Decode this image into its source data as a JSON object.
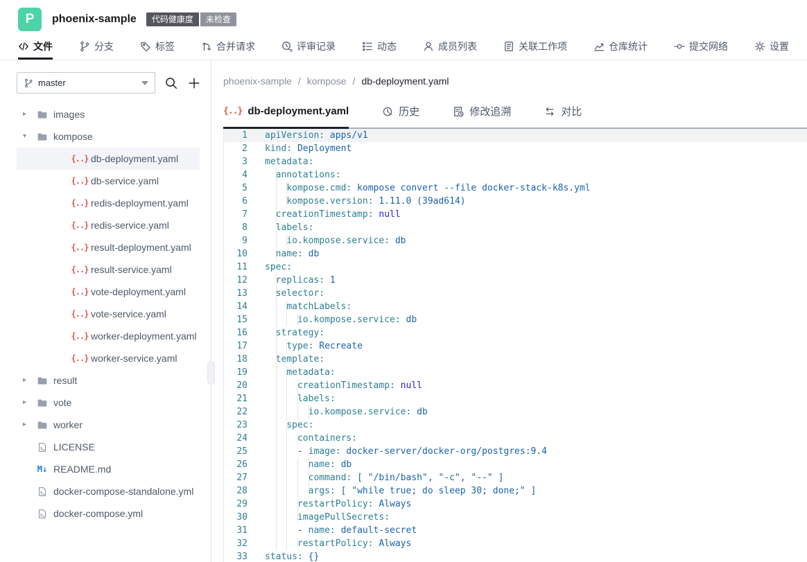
{
  "header": {
    "logo_letter": "P",
    "project_name": "phoenix-sample",
    "badges": [
      {
        "label": "代码健康度"
      },
      {
        "label": "未检查"
      }
    ],
    "nav": [
      {
        "id": "files",
        "icon": "code",
        "label": "文件",
        "active": true
      },
      {
        "id": "branches",
        "icon": "branch",
        "label": "分支"
      },
      {
        "id": "tags",
        "icon": "tag",
        "label": "标签"
      },
      {
        "id": "merge-requests",
        "icon": "merge",
        "label": "合并请求"
      },
      {
        "id": "reviews",
        "icon": "review",
        "label": "评审记录"
      },
      {
        "id": "activity",
        "icon": "activity",
        "label": "动态"
      },
      {
        "id": "members",
        "icon": "members",
        "label": "成员列表"
      },
      {
        "id": "work-items",
        "icon": "workitem",
        "label": "关联工作项"
      },
      {
        "id": "repo-stats",
        "icon": "stats",
        "label": "仓库统计"
      },
      {
        "id": "commit-network",
        "icon": "network",
        "label": "提交网络"
      },
      {
        "id": "settings",
        "icon": "gear",
        "label": "设置"
      }
    ]
  },
  "sidebar": {
    "branch": "master",
    "tree": [
      {
        "type": "folder",
        "label": "images",
        "depth": 0,
        "expanded": false
      },
      {
        "type": "folder",
        "label": "kompose",
        "depth": 0,
        "expanded": true
      },
      {
        "type": "yaml",
        "label": "db-deployment.yaml",
        "depth": 1,
        "selected": true
      },
      {
        "type": "yaml",
        "label": "db-service.yaml",
        "depth": 1
      },
      {
        "type": "yaml",
        "label": "redis-deployment.yaml",
        "depth": 1
      },
      {
        "type": "yaml",
        "label": "redis-service.yaml",
        "depth": 1
      },
      {
        "type": "yaml",
        "label": "result-deployment.yaml",
        "depth": 1
      },
      {
        "type": "yaml",
        "label": "result-service.yaml",
        "depth": 1
      },
      {
        "type": "yaml",
        "label": "vote-deployment.yaml",
        "depth": 1
      },
      {
        "type": "yaml",
        "label": "vote-service.yaml",
        "depth": 1
      },
      {
        "type": "yaml",
        "label": "worker-deployment.yaml",
        "depth": 1
      },
      {
        "type": "yaml",
        "label": "worker-service.yaml",
        "depth": 1
      },
      {
        "type": "folder",
        "label": "result",
        "depth": 0,
        "expanded": false
      },
      {
        "type": "folder",
        "label": "vote",
        "depth": 0,
        "expanded": false
      },
      {
        "type": "folder",
        "label": "worker",
        "depth": 0,
        "expanded": false
      },
      {
        "type": "file",
        "label": "LICENSE",
        "depth": 0
      },
      {
        "type": "md",
        "label": "README.md",
        "depth": 0
      },
      {
        "type": "file",
        "label": "docker-compose-standalone.yml",
        "depth": 0
      },
      {
        "type": "file",
        "label": "docker-compose.yml",
        "depth": 0
      }
    ]
  },
  "main": {
    "breadcrumb": [
      "phoenix-sample",
      "kompose",
      "db-deployment.yaml"
    ],
    "tabs": [
      {
        "id": "file",
        "icon": "yaml",
        "label": "db-deployment.yaml",
        "active": true
      },
      {
        "id": "history",
        "icon": "history",
        "label": "历史"
      },
      {
        "id": "blame",
        "icon": "blame",
        "label": "修改追溯"
      },
      {
        "id": "compare",
        "icon": "compare",
        "label": "对比"
      }
    ],
    "code": {
      "lines": [
        "apiVersion: apps/v1",
        "kind: Deployment",
        "metadata:",
        "  annotations:",
        "    kompose.cmd: kompose convert --file docker-stack-k8s.yml",
        "    kompose.version: 1.11.0 (39ad614)",
        "  creationTimestamp: null",
        "  labels:",
        "    io.kompose.service: db",
        "  name: db",
        "spec:",
        "  replicas: 1",
        "  selector:",
        "    matchLabels:",
        "      io.kompose.service: db",
        "  strategy:",
        "    type: Recreate",
        "  template:",
        "    metadata:",
        "      creationTimestamp: null",
        "      labels:",
        "        io.kompose.service: db",
        "    spec:",
        "      containers:",
        "      - image: docker-server/docker-org/postgres:9.4",
        "        name: db",
        "        command: [ \"/bin/bash\", \"-c\", \"--\" ]",
        "        args: [ \"while true; do sleep 30; done;\" ]",
        "      restartPolicy: Always",
        "      imagePullSecrets:",
        "      - name: default-secret",
        "      restartPolicy: Always",
        "status: {}"
      ]
    }
  },
  "colors": {
    "accent": "#4ed3a5",
    "yaml_icon": "#e8564e",
    "md_icon": "#1e7ce8",
    "code_key": "#2c7f93",
    "code_value": "#1a63ae",
    "code_keyword": "#2525d8",
    "line_number": "#2d7f93",
    "active_tab_underline": "#1d2129"
  }
}
